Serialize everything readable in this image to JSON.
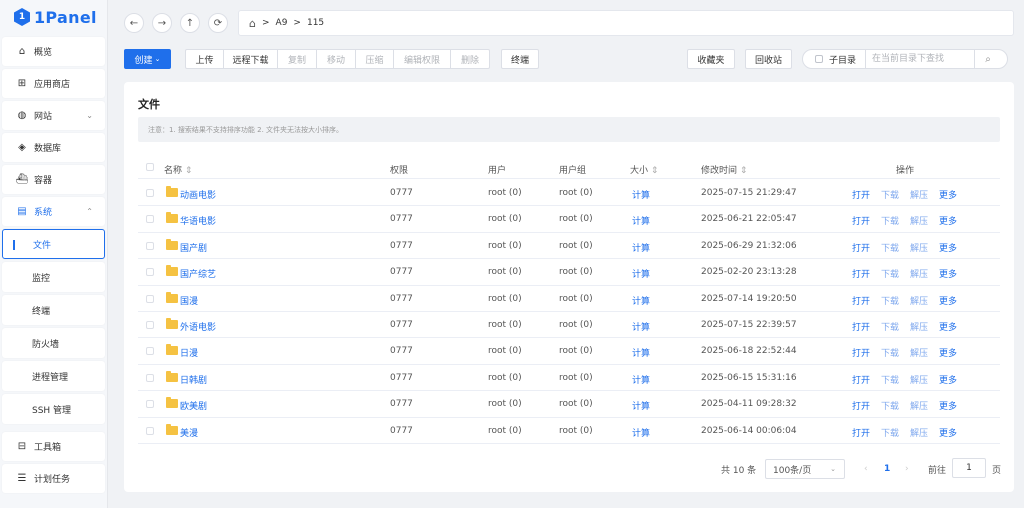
{
  "brand": {
    "name": "1Panel"
  },
  "sidebar": {
    "items": [
      {
        "label": "概览",
        "icon": "home-icon"
      },
      {
        "label": "应用商店",
        "icon": "apps-icon"
      },
      {
        "label": "网站",
        "icon": "globe-icon",
        "chevron": "down"
      },
      {
        "label": "数据库",
        "icon": "database-icon"
      },
      {
        "label": "容器",
        "icon": "container-icon"
      },
      {
        "label": "系统",
        "icon": "system-icon",
        "chevron": "up",
        "open": true
      }
    ],
    "system_children": [
      "文件",
      "监控",
      "终端",
      "防火墙",
      "进程管理",
      "SSH 管理"
    ],
    "active_child": "文件",
    "bottom_items": [
      {
        "label": "工具箱",
        "icon": "toolbox-icon"
      },
      {
        "label": "计划任务",
        "icon": "cron-icon"
      }
    ]
  },
  "pathbar": {
    "segments": [
      "A9",
      "115"
    ],
    "separator": ">"
  },
  "toolbar": {
    "create": "创建",
    "upload": "上传",
    "remote_download": "远程下载",
    "copy": "复制",
    "move": "移动",
    "compress": "压缩",
    "edit_perm": "编辑权限",
    "delete": "删除",
    "terminal": "终端",
    "favorites": "收藏夹",
    "recycle": "回收站",
    "subdir": "子目录",
    "search_placeholder": "在当前目录下查找"
  },
  "card": {
    "title": "文件",
    "note": "注意：1. 搜索结果不支持排序功能 2. 文件夹无法按大小排序。"
  },
  "table": {
    "headers": {
      "name": "名称",
      "perm": "权限",
      "user": "用户",
      "group": "用户组",
      "size": "大小",
      "mtime": "修改时间",
      "ops": "操作"
    },
    "actions": [
      "打开",
      "下载",
      "解压",
      "更多"
    ],
    "rows": [
      {
        "name": "动画电影",
        "perm": "0777",
        "user": "root (0)",
        "group": "root (0)",
        "size": "计算",
        "mtime": "2025-07-15 21:29:47"
      },
      {
        "name": "华语电影",
        "perm": "0777",
        "user": "root (0)",
        "group": "root (0)",
        "size": "计算",
        "mtime": "2025-06-21 22:05:47"
      },
      {
        "name": "国产剧",
        "perm": "0777",
        "user": "root (0)",
        "group": "root (0)",
        "size": "计算",
        "mtime": "2025-06-29 21:32:06"
      },
      {
        "name": "国产综艺",
        "perm": "0777",
        "user": "root (0)",
        "group": "root (0)",
        "size": "计算",
        "mtime": "2025-02-20 23:13:28"
      },
      {
        "name": "国漫",
        "perm": "0777",
        "user": "root (0)",
        "group": "root (0)",
        "size": "计算",
        "mtime": "2025-07-14 19:20:50"
      },
      {
        "name": "外语电影",
        "perm": "0777",
        "user": "root (0)",
        "group": "root (0)",
        "size": "计算",
        "mtime": "2025-07-15 22:39:57"
      },
      {
        "name": "日漫",
        "perm": "0777",
        "user": "root (0)",
        "group": "root (0)",
        "size": "计算",
        "mtime": "2025-06-18 22:52:44"
      },
      {
        "name": "日韩剧",
        "perm": "0777",
        "user": "root (0)",
        "group": "root (0)",
        "size": "计算",
        "mtime": "2025-06-15 15:31:16"
      },
      {
        "name": "欧美剧",
        "perm": "0777",
        "user": "root (0)",
        "group": "root (0)",
        "size": "计算",
        "mtime": "2025-04-11 09:28:32"
      },
      {
        "name": "美漫",
        "perm": "0777",
        "user": "root (0)",
        "group": "root (0)",
        "size": "计算",
        "mtime": "2025-06-14 00:06:04"
      }
    ]
  },
  "pagination": {
    "total": "共 10 条",
    "page_size": "100条/页",
    "current": "1",
    "goto_label": "前往",
    "goto_value": "1",
    "page_unit": "页"
  },
  "colors": {
    "accent": "#1f6feb",
    "folder": "#f5c242"
  }
}
